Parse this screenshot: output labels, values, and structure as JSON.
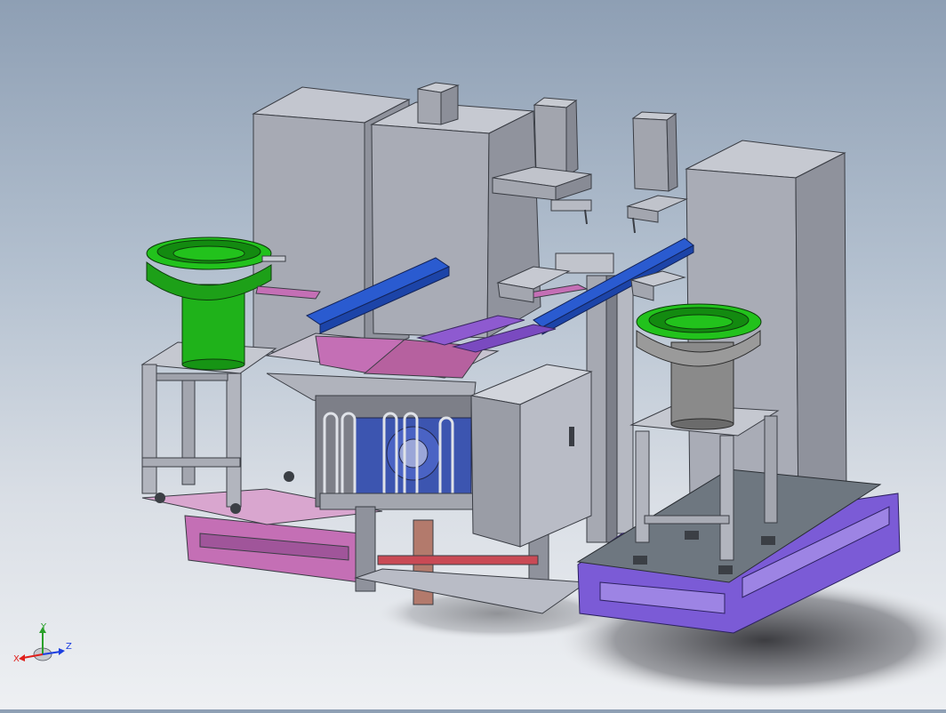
{
  "viewport": {
    "background_top": "#8e9fb4",
    "background_bottom": "#eef0f3"
  },
  "triad": {
    "x_label": "X",
    "y_label": "Y",
    "z_label": "Z",
    "x_color": "#e0201c",
    "y_color": "#2aa02a",
    "z_color": "#1c3fe0"
  },
  "model": {
    "colors": {
      "cabinet": "#a9acb6",
      "frame": "#b8bcc6",
      "green_bowl": "#22c21c",
      "gray_bowl": "#8a8a8a",
      "blue_beam": "#2a5bd0",
      "pink_base": "#c46fb5",
      "purple_base": "#7b5bd6",
      "slate_plate": "#6e7780",
      "control_box": "#b9bcc6"
    }
  }
}
